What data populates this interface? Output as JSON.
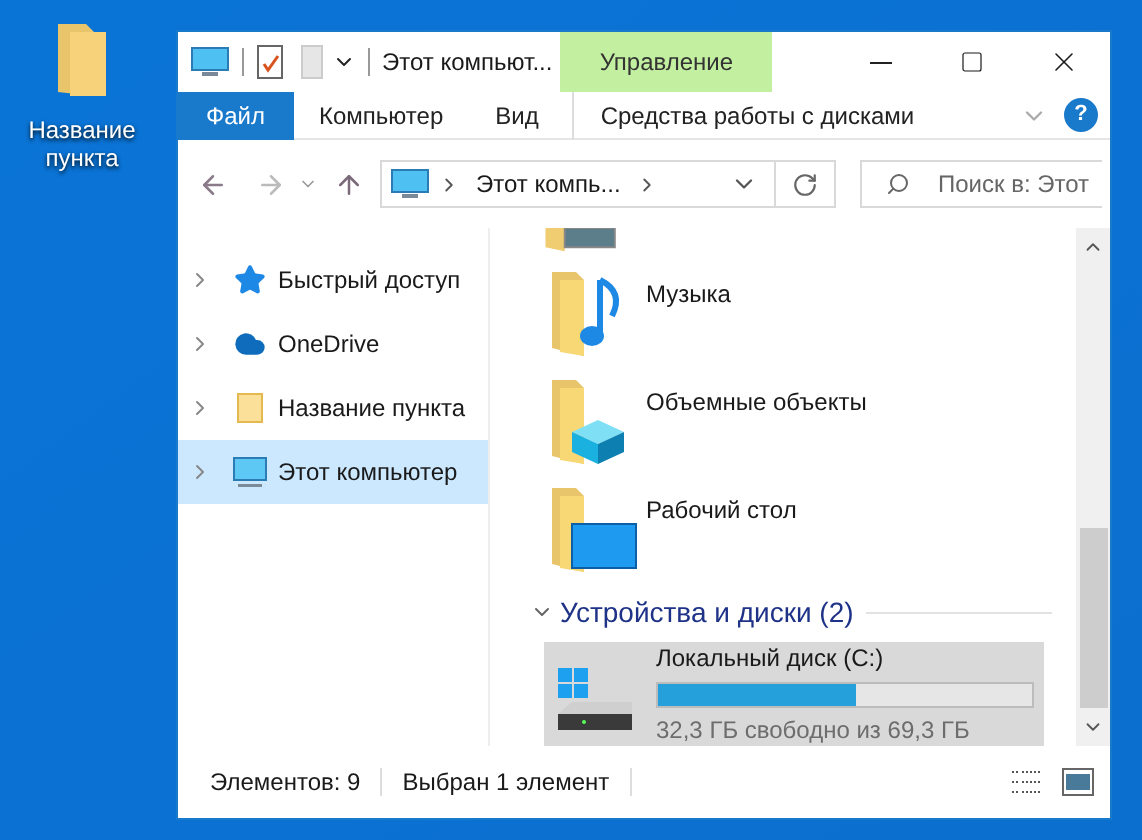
{
  "desktop_icon": {
    "label": "Название пункта"
  },
  "window": {
    "title": "Этот компьют...",
    "context_tab": "Управление"
  },
  "ribbon_tabs": [
    {
      "label": "Файл",
      "selected": true
    },
    {
      "label": "Компьютер",
      "selected": false
    },
    {
      "label": "Вид",
      "selected": false
    },
    {
      "label": "Средства работы с дисками",
      "selected": false
    }
  ],
  "help_button": "?",
  "address": {
    "path": "Этот компь...",
    "search_placeholder": "Поиск в: Этот"
  },
  "nav": [
    {
      "label": "Быстрый доступ",
      "kind": "star",
      "selected": false
    },
    {
      "label": "OneDrive",
      "kind": "cloud",
      "selected": false
    },
    {
      "label": "Название пункта",
      "kind": "folder",
      "selected": false
    },
    {
      "label": "Этот компьютер",
      "kind": "computer",
      "selected": true
    }
  ],
  "folders": [
    {
      "label": "Музыка",
      "kind": "music"
    },
    {
      "label": "Объемные объекты",
      "kind": "cube"
    },
    {
      "label": "Рабочий стол",
      "kind": "desktop"
    }
  ],
  "group": {
    "title": "Устройства и диски (2)",
    "expanded": true
  },
  "drive": {
    "name": "Локальный диск (C:)",
    "level": 0.53,
    "free": "32,3 ГБ свободно из 69,3 ГБ",
    "selected": true
  },
  "status_bar": {
    "items_count": "Элементов: 9",
    "selection": "Выбран 1 элемент"
  }
}
